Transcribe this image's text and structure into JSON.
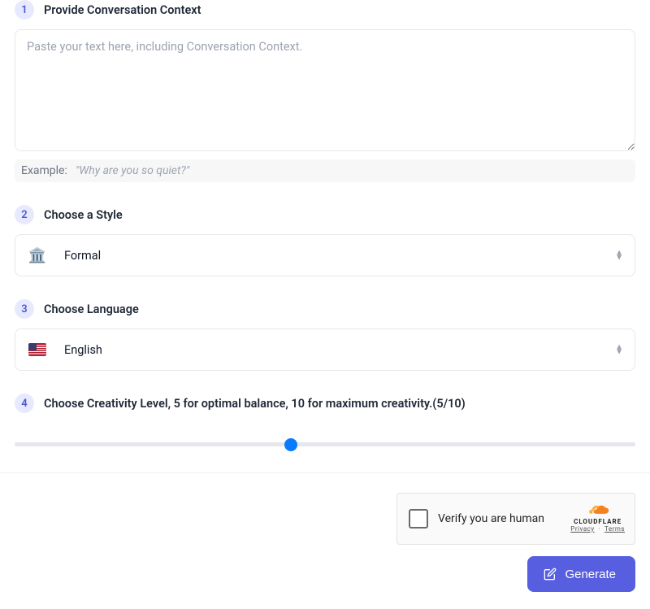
{
  "steps": {
    "context": {
      "num": "1",
      "title": "Provide Conversation Context",
      "placeholder": "Paste your text here, including Conversation Context.",
      "value": "",
      "example_label": "Example:",
      "example_text": "\"Why are you so quiet?\""
    },
    "style": {
      "num": "2",
      "title": "Choose a Style",
      "icon": "🏛️",
      "value": "Formal"
    },
    "language": {
      "num": "3",
      "title": "Choose Language",
      "value": "English"
    },
    "creativity": {
      "num": "4",
      "title": "Choose Creativity Level, 5 for optimal balance, 10 for maximum creativity.(5/10)",
      "value": 5,
      "min": 1,
      "max": 10
    }
  },
  "captcha": {
    "label": "Verify you are human",
    "brand": "CLOUDFLARE",
    "privacy": "Privacy",
    "terms": "Terms"
  },
  "actions": {
    "generate": "Generate"
  }
}
